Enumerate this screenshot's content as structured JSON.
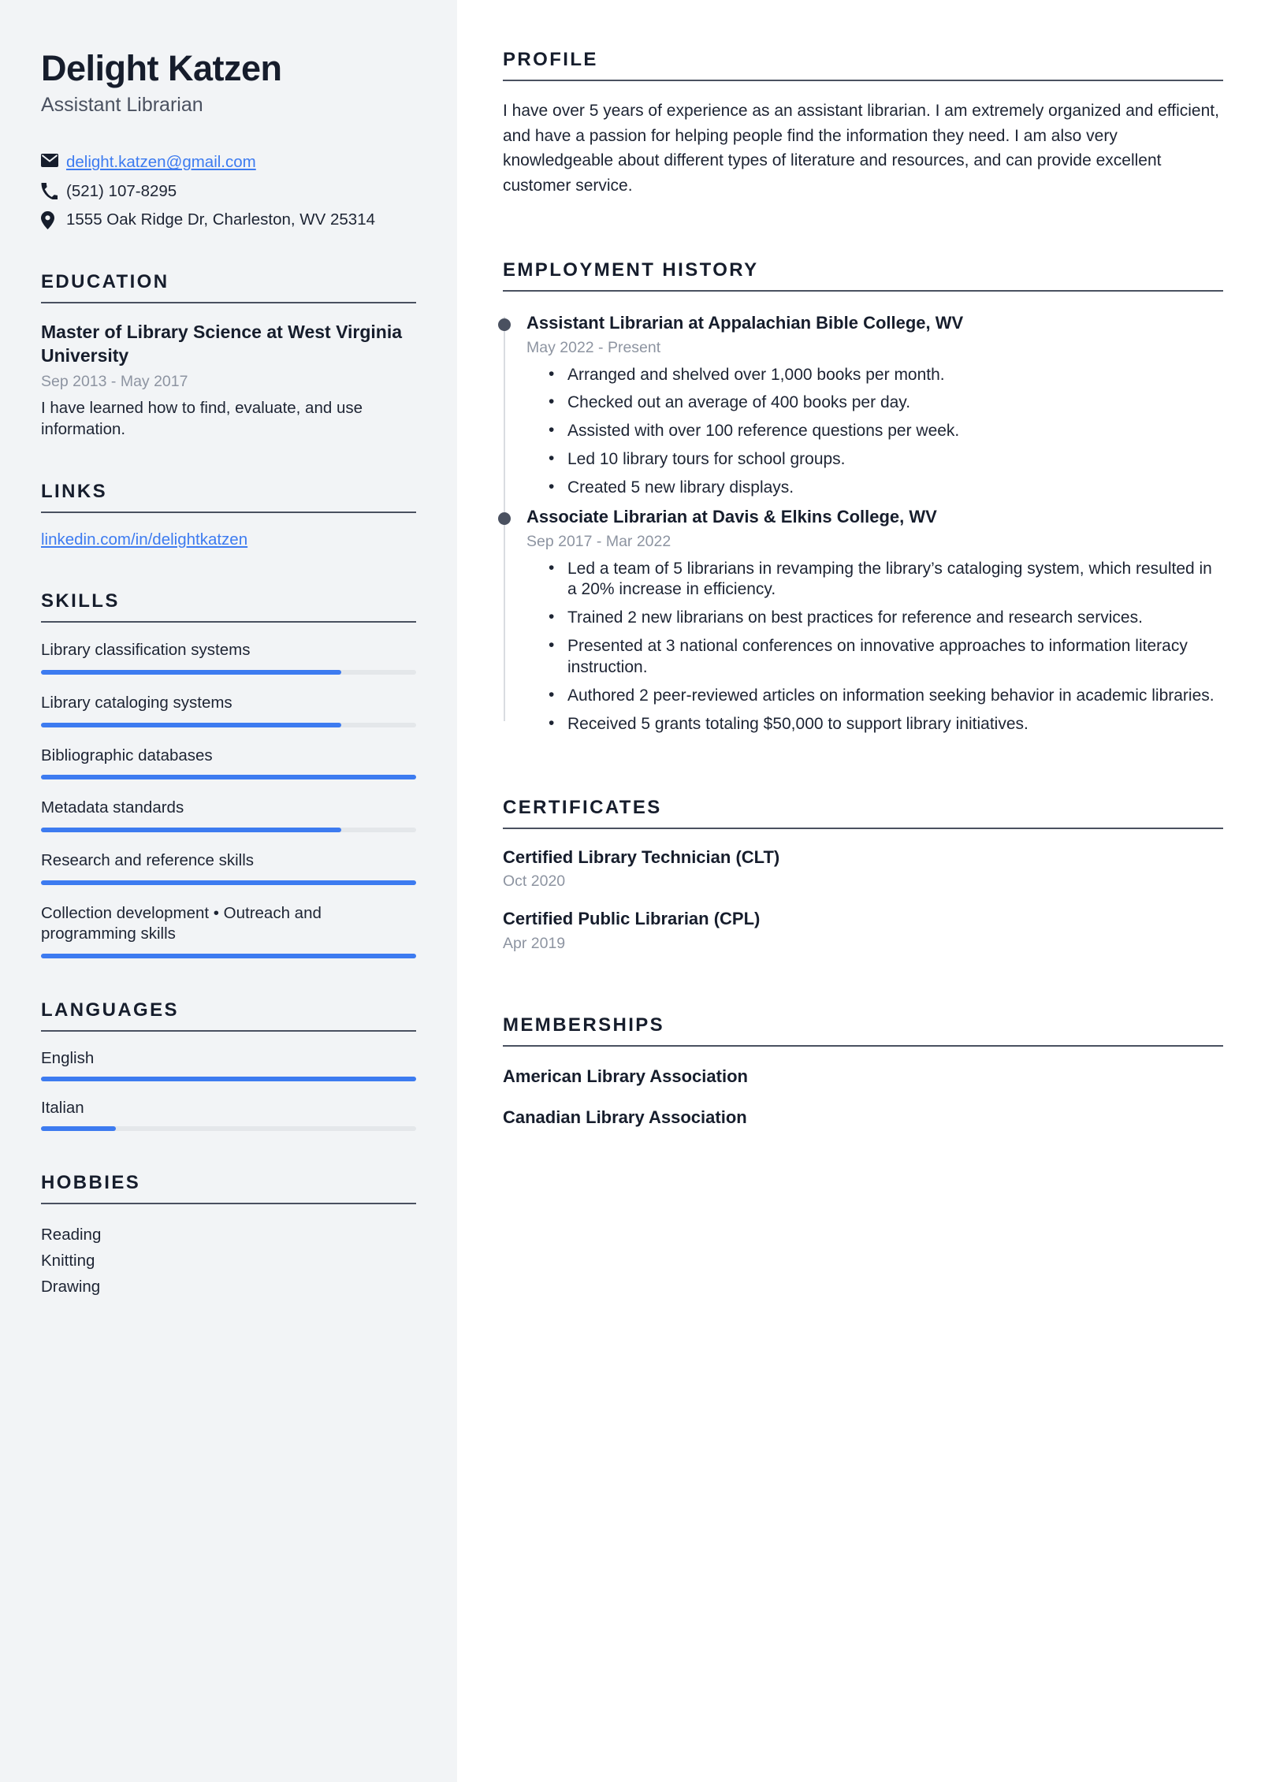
{
  "sidebar": {
    "name": "Delight Katzen",
    "job_title": "Assistant Librarian",
    "contact": {
      "email": "delight.katzen@gmail.com",
      "phone": "(521) 107-8295",
      "address": "1555 Oak Ridge Dr, Charleston, WV 25314"
    },
    "education": {
      "heading": "EDUCATION",
      "items": [
        {
          "title": "Master of Library Science at West Virginia University",
          "date": "Sep 2013 - May 2017",
          "description": "I have learned how to find, evaluate, and use information."
        }
      ]
    },
    "links": {
      "heading": "LINKS",
      "items": [
        {
          "label": "linkedin.com/in/delightkatzen"
        }
      ]
    },
    "skills": {
      "heading": "SKILLS",
      "items": [
        {
          "label": "Library classification systems",
          "level": 80
        },
        {
          "label": "Library cataloging systems",
          "level": 80
        },
        {
          "label": "Bibliographic databases",
          "level": 100
        },
        {
          "label": "Metadata standards",
          "level": 80
        },
        {
          "label": "Research and reference skills",
          "level": 100
        },
        {
          "label": "Collection development • Outreach and programming skills",
          "level": 100
        }
      ]
    },
    "languages": {
      "heading": "LANGUAGES",
      "items": [
        {
          "label": "English",
          "level": 100
        },
        {
          "label": "Italian",
          "level": 20
        }
      ]
    },
    "hobbies": {
      "heading": "HOBBIES",
      "items": [
        {
          "label": "Reading"
        },
        {
          "label": "Knitting"
        },
        {
          "label": "Drawing"
        }
      ]
    }
  },
  "main": {
    "profile": {
      "heading": "PROFILE",
      "text": "I have over 5 years of experience as an assistant librarian. I am extremely organized and efficient, and have a passion for helping people find the information they need. I am also very knowledgeable about different types of literature and resources, and can provide excellent customer service."
    },
    "employment": {
      "heading": "EMPLOYMENT HISTORY",
      "jobs": [
        {
          "title": "Assistant Librarian at Appalachian Bible College, WV",
          "date": "May 2022 - Present",
          "bullets": [
            "Arranged and shelved over 1,000 books per month.",
            "Checked out an average of 400 books per day.",
            "Assisted with over 100 reference questions per week.",
            "Led 10 library tours for school groups.",
            "Created 5 new library displays."
          ]
        },
        {
          "title": "Associate Librarian at Davis & Elkins College, WV",
          "date": "Sep 2017 - Mar 2022",
          "bullets": [
            "Led a team of 5 librarians in revamping the library’s cataloging system, which resulted in a 20% increase in efficiency.",
            "Trained 2 new librarians on best practices for reference and research services.",
            "Presented at 3 national conferences on innovative approaches to information literacy instruction.",
            "Authored 2 peer-reviewed articles on information seeking behavior in academic libraries.",
            "Received 5 grants totaling $50,000 to support library initiatives."
          ]
        }
      ]
    },
    "certificates": {
      "heading": "CERTIFICATES",
      "items": [
        {
          "title": "Certified Library Technician (CLT)",
          "date": "Oct 2020"
        },
        {
          "title": "Certified Public Librarian (CPL)",
          "date": "Apr 2019"
        }
      ]
    },
    "memberships": {
      "heading": "MEMBERSHIPS",
      "items": [
        {
          "label": "American Library Association"
        },
        {
          "label": "Canadian Library Association"
        }
      ]
    }
  },
  "colors": {
    "accent": "#3d7bf0",
    "sidebar_bg": "#f2f4f6",
    "heading": "#161d2c",
    "muted": "#8d94a1",
    "rule": "#4a5160"
  }
}
